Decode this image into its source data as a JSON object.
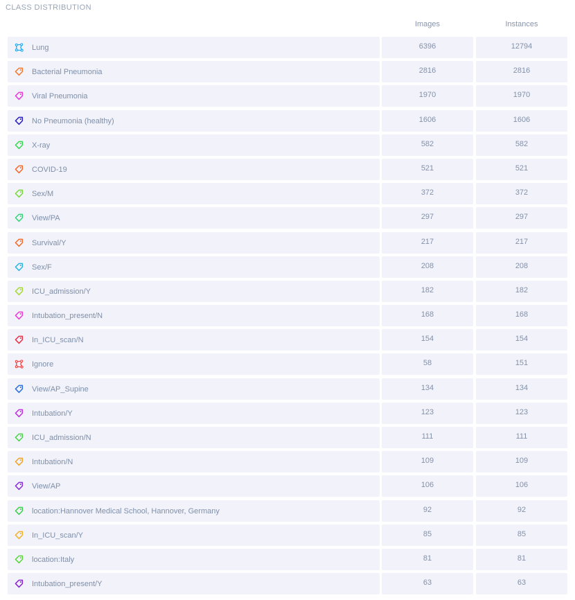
{
  "title": "CLASS DISTRIBUTION",
  "columns": {
    "images": "Images",
    "instances": "Instances"
  },
  "rows": [
    {
      "name": "Lung",
      "icon": "polygon-icon",
      "color": "#1aa3e8",
      "images": "6396",
      "instances": "12794"
    },
    {
      "name": "Bacterial Pneumonia",
      "icon": "tag-icon",
      "color": "#f47a2f",
      "images": "2816",
      "instances": "2816"
    },
    {
      "name": "Viral Pneumonia",
      "icon": "tag-icon",
      "color": "#e63ad8",
      "images": "1970",
      "instances": "1970"
    },
    {
      "name": "No Pneumonia (healthy)",
      "icon": "tag-icon",
      "color": "#2a1fc0",
      "images": "1606",
      "instances": "1606"
    },
    {
      "name": "X-ray",
      "icon": "tag-icon",
      "color": "#37d94f",
      "images": "582",
      "instances": "582"
    },
    {
      "name": "COVID-19",
      "icon": "tag-icon",
      "color": "#f46a2a",
      "images": "521",
      "instances": "521"
    },
    {
      "name": "Sex/M",
      "icon": "tag-icon",
      "color": "#7ad83a",
      "images": "372",
      "instances": "372"
    },
    {
      "name": "View/PA",
      "icon": "tag-icon",
      "color": "#36d47a",
      "images": "297",
      "instances": "297"
    },
    {
      "name": "Survival/Y",
      "icon": "tag-icon",
      "color": "#f46b2a",
      "images": "217",
      "instances": "217"
    },
    {
      "name": "Sex/F",
      "icon": "tag-icon",
      "color": "#2ab6e0",
      "images": "208",
      "instances": "208"
    },
    {
      "name": "ICU_admission/Y",
      "icon": "tag-icon",
      "color": "#a6d836",
      "images": "182",
      "instances": "182"
    },
    {
      "name": "Intubation_present/N",
      "icon": "tag-icon",
      "color": "#ec3ad6",
      "images": "168",
      "instances": "168"
    },
    {
      "name": "In_ICU_scan/N",
      "icon": "tag-icon",
      "color": "#e8304a",
      "images": "154",
      "instances": "154"
    },
    {
      "name": "Ignore",
      "icon": "polygon-icon",
      "color": "#ee3b3b",
      "images": "58",
      "instances": "151"
    },
    {
      "name": "View/AP_Supine",
      "icon": "tag-icon",
      "color": "#2a6fd8",
      "images": "134",
      "instances": "134"
    },
    {
      "name": "Intubation/Y",
      "icon": "tag-icon",
      "color": "#c12ee0",
      "images": "123",
      "instances": "123"
    },
    {
      "name": "ICU_admission/N",
      "icon": "tag-icon",
      "color": "#4bd44a",
      "images": "111",
      "instances": "111"
    },
    {
      "name": "Intubation/N",
      "icon": "tag-icon",
      "color": "#f0a52a",
      "images": "109",
      "instances": "109"
    },
    {
      "name": "View/AP",
      "icon": "tag-icon",
      "color": "#8a2ed8",
      "images": "106",
      "instances": "106"
    },
    {
      "name": "location:Hannover Medical School, Hannover, Germany",
      "icon": "tag-icon",
      "color": "#3fcf4a",
      "images": "92",
      "instances": "92"
    },
    {
      "name": "In_ICU_scan/Y",
      "icon": "tag-icon",
      "color": "#f2b22a",
      "images": "85",
      "instances": "85"
    },
    {
      "name": "location:Italy",
      "icon": "tag-icon",
      "color": "#5ad63a",
      "images": "81",
      "instances": "81"
    },
    {
      "name": "Intubation_present/Y",
      "icon": "tag-icon",
      "color": "#8a22cf",
      "images": "63",
      "instances": "63"
    }
  ]
}
